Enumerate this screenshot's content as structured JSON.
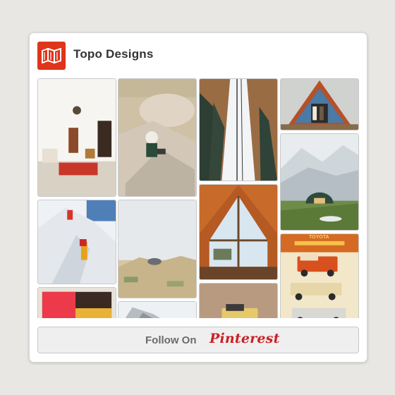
{
  "widget": {
    "board_name": "Topo Designs",
    "logo_icon": "topo-map-icon",
    "follow_label": "Follow On",
    "pinterest_label": "Pinterest"
  },
  "colors": {
    "brand_red": "#e0341b",
    "pinterest_red": "#cb2027",
    "card_bg": "#ffffff",
    "button_bg": "#efefef"
  },
  "pins": [
    {
      "subject": "interior-room"
    },
    {
      "subject": "desert-climber"
    },
    {
      "subject": "snowy-ski-lift"
    },
    {
      "subject": "a-frame-cabin"
    },
    {
      "subject": "mountain-dome"
    },
    {
      "subject": "ice-climbers"
    },
    {
      "subject": "desert-tent"
    },
    {
      "subject": "a-frame-window"
    },
    {
      "subject": "toyota-ad"
    },
    {
      "subject": "wool-blanket"
    },
    {
      "subject": "snow-rock"
    },
    {
      "subject": "vintage-truck"
    }
  ],
  "toyota_ad": {
    "brand": "TOYOTA"
  }
}
